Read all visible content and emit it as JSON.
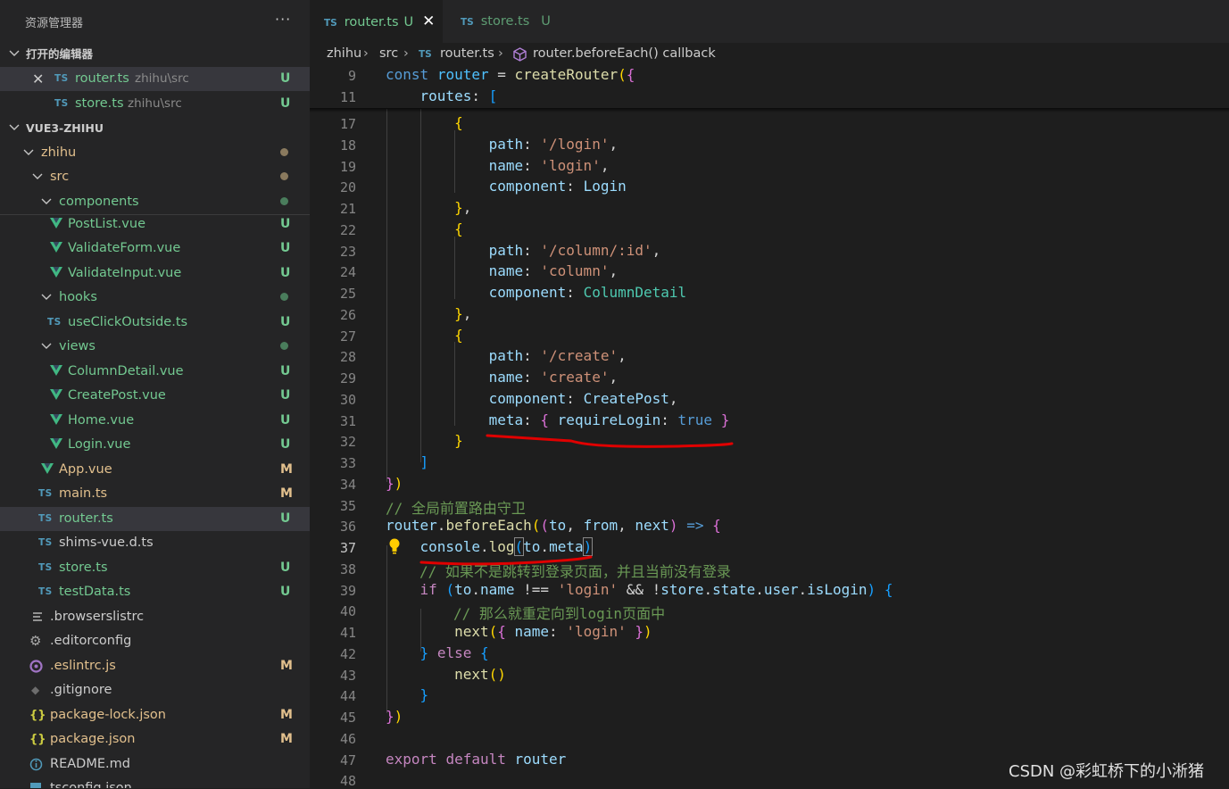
{
  "explorer": {
    "title": "资源管理器",
    "more": "···",
    "open_editors_label": "打开的编辑器",
    "open_editors": [
      {
        "name": "router.ts",
        "path": "zhihu\\src",
        "status": "U"
      },
      {
        "name": "store.ts",
        "path": "zhihu\\src",
        "status": "U"
      }
    ],
    "project_label": "VUE3-ZHIHU",
    "tree": {
      "zhihu": "zhihu",
      "src": "src",
      "components": "components",
      "postlist": "PostList.vue",
      "validateform": "ValidateForm.vue",
      "validateinput": "ValidateInput.vue",
      "hooks": "hooks",
      "useclickoutside": "useClickOutside.ts",
      "views": "views",
      "columndetail": "ColumnDetail.vue",
      "createpost": "CreatePost.vue",
      "home": "Home.vue",
      "login": "Login.vue",
      "app": "App.vue",
      "main": "main.ts",
      "router": "router.ts",
      "shims": "shims-vue.d.ts",
      "store": "store.ts",
      "testdata": "testData.ts",
      "browserslist": ".browserslistrc",
      "editorconfig": ".editorconfig",
      "eslintrc": ".eslintrc.js",
      "gitignore": ".gitignore",
      "packagelock": "package-lock.json",
      "package": "package.json",
      "readme": "README.md",
      "tsconfig": "tsconfig.json"
    },
    "status": {
      "u": "U",
      "m": "M"
    },
    "ts_badge": "TS",
    "json_badge": "{}"
  },
  "tabs": [
    {
      "badge": "TS",
      "name": "router.ts",
      "mark": "U",
      "close": "✕"
    },
    {
      "badge": "TS",
      "name": "store.ts",
      "mark": "U"
    }
  ],
  "breadcrumb": {
    "parts": [
      "zhihu",
      "src",
      "router.ts",
      "router.beforeEach() callback"
    ],
    "sep": "›"
  },
  "editor": {
    "line_numbers": [
      "9",
      "11",
      "17",
      "18",
      "19",
      "20",
      "21",
      "22",
      "23",
      "24",
      "25",
      "26",
      "27",
      "28",
      "29",
      "30",
      "31",
      "32",
      "33",
      "34",
      "35",
      "36",
      "37",
      "38",
      "39",
      "40",
      "41",
      "42",
      "43",
      "44",
      "45",
      "46",
      "47",
      "48"
    ],
    "current_line": "37",
    "comments": {
      "c35": "// 全局前置路由守卫",
      "c38": "// 如果不是跳转到登录页面，并且当前没有登录",
      "c40": "// 那么就重定向到login页面中"
    },
    "strings": {
      "login_path": "'/login'",
      "login_name": "'login'",
      "column_path": "'/column/:id'",
      "column_name": "'column'",
      "create_path": "'/create'",
      "create_name": "'create'"
    }
  },
  "watermark": "CSDN @彩虹桥下的小淅猪",
  "colors": {
    "accent": "#73c991",
    "modified": "#e2c08d",
    "annotation": "#e00000"
  }
}
